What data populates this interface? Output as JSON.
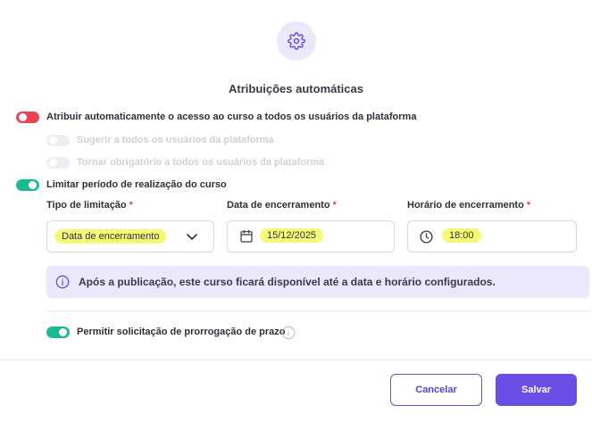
{
  "header": {
    "icon": "gear-icon",
    "title": "Atribuições automáticas"
  },
  "options": {
    "auto_assign": {
      "label": "Atribuir automaticamente o acesso ao curso a todos os usuários da plataforma",
      "state": "off",
      "color": "#ee4055"
    },
    "suggest_all": {
      "label": "Sugerir a todos os usuários da plataforma",
      "state": "disabled"
    },
    "mandatory_all": {
      "label": "Tornar obrigatório a todos os usuários da plataforma",
      "state": "disabled"
    },
    "limit_period": {
      "label": "Limitar período de realização do curso",
      "state": "on",
      "color": "#1db993"
    }
  },
  "fields": {
    "limit_type": {
      "label": "Tipo de limitação",
      "required_mark": "*",
      "value": "Data de encerramento"
    },
    "end_date": {
      "label": "Data de encerramento",
      "required_mark": "*",
      "value": "15/12/2025"
    },
    "end_time": {
      "label": "Horário de encerramento",
      "required_mark": "*",
      "value": "18:00"
    }
  },
  "info": {
    "text": "Após a publicação, este curso ficará disponível até a data e horário configurados."
  },
  "extension": {
    "label": "Permitir solicitação de prorrogação de prazo",
    "state": "on"
  },
  "footer": {
    "cancel_label": "Cancelar",
    "save_label": "Salvar"
  },
  "colors": {
    "accent": "#6b4ee6",
    "highlight": "#f5fb75",
    "info_bg": "#ece8fb",
    "required": "#ee4055"
  }
}
